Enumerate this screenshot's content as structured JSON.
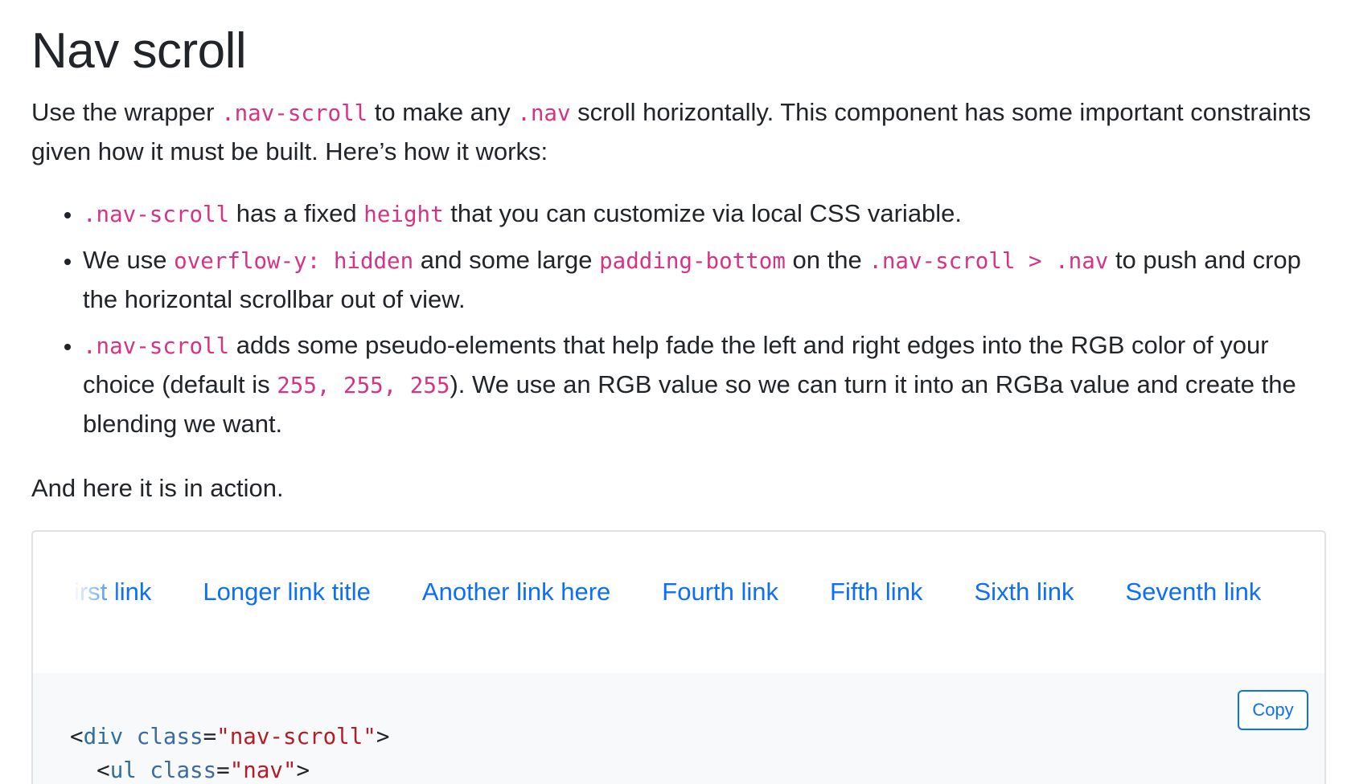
{
  "title": "Nav scroll",
  "intro": {
    "t1": "Use the wrapper ",
    "code1": ".nav-scroll",
    "t2": " to make any ",
    "code2": ".nav",
    "t3": " scroll horizontally. This component has some important constraints given how it must be built. Here’s how it works:"
  },
  "bullets": [
    {
      "code1": ".nav-scroll",
      "t1": " has a fixed ",
      "code2": "height",
      "t2": " that you can customize via local CSS variable."
    },
    {
      "t1": "We use ",
      "code1": "overflow-y: hidden",
      "t2": " and some large ",
      "code2": "padding-bottom",
      "t3": " on the ",
      "code3": ".nav-scroll > .nav",
      "t4": " to push and crop the horizontal scrollbar out of view."
    },
    {
      "code1": ".nav-scroll",
      "t1": " adds some pseudo-elements that help fade the left and right edges into the RGB color of your choice (default is ",
      "code2": "255, 255, 255",
      "t2": "). We use an RGB value so we can turn it into an RGBa value and create the blending we want."
    }
  ],
  "action_text": "And here it is in action.",
  "nav_links": [
    "First link",
    "Longer link title",
    "Another link here",
    "Fourth link",
    "Fifth link",
    "Sixth link",
    "Seventh link"
  ],
  "code": {
    "copy_label": "Copy",
    "line1": {
      "open": "<",
      "tag": "div",
      "attr": "class",
      "eq": "=",
      "value": "\"nav-scroll\"",
      "close": ">"
    },
    "line2": {
      "indent": "  ",
      "open": "<",
      "tag": "ul",
      "attr": "class",
      "eq": "=",
      "value": "\"nav\"",
      "close": ">"
    }
  },
  "colors": {
    "link": "#0d6efd",
    "code_inline": "#d63384",
    "text": "#212529",
    "border": "#dee2e6",
    "code_bg": "#f8f9fa",
    "fade_rgb": "255, 255, 255"
  }
}
